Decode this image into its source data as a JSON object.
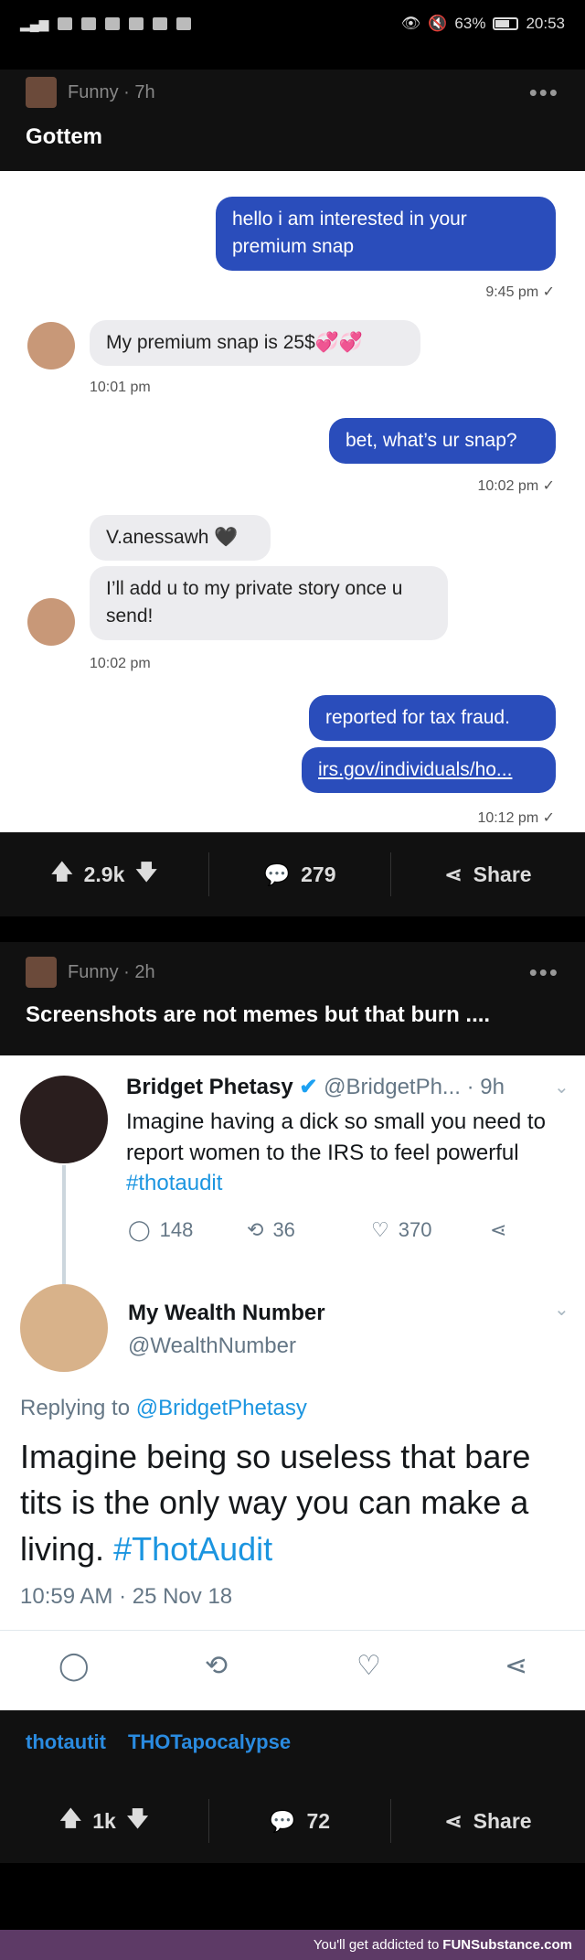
{
  "status_bar": {
    "battery": "63%",
    "time": "20:53"
  },
  "post1": {
    "community": "Funny · 7h",
    "title": "Gottem",
    "messages": [
      {
        "text": "hello i am interested in your premium snap",
        "time": "9:45 pm ✓"
      },
      {
        "text": "My premium snap is 25$💞💞",
        "time": "10:01 pm"
      },
      {
        "text": "bet, what’s ur snap?",
        "time": "10:02 pm ✓"
      },
      {
        "text": "V.anessawh 🖤"
      },
      {
        "text": "I’ll add u to my private story once u send!",
        "time": "10:02 pm"
      },
      {
        "text": "reported for tax fraud."
      },
      {
        "text": "irs.gov/individuals/ho...",
        "time": "10:12 pm ✓"
      }
    ],
    "votes": "2.9k",
    "comments": "279",
    "share": "Share"
  },
  "post2": {
    "community": "Funny · 2h",
    "title": "Screenshots are not memes but that burn ....",
    "tweet1": {
      "name": "Bridget Phetasy",
      "handle": "@BridgetPh...",
      "age": "· 9h",
      "text": "Imagine having a dick so small you need to report women to the IRS to feel powerful",
      "hashtag": "#thotaudit",
      "replies": "148",
      "retweets": "36",
      "likes": "370"
    },
    "tweet2": {
      "name": "My Wealth Number",
      "handle": "@WealthNumber",
      "replying_prefix": "Replying to",
      "replying_to": "@BridgetPhetasy",
      "text": "Imagine being so useless that bare tits is the only way you can make a living.",
      "hashtag": "#ThotAudit",
      "timestamp": "10:59 AM · 25 Nov 18"
    },
    "tags": [
      "thotautit",
      "THOTapocalypse"
    ],
    "votes": "1k",
    "comments": "72",
    "share": "Share"
  },
  "footer": {
    "text": "You'll get addicted to",
    "brand": "FUNSubstance.com"
  }
}
